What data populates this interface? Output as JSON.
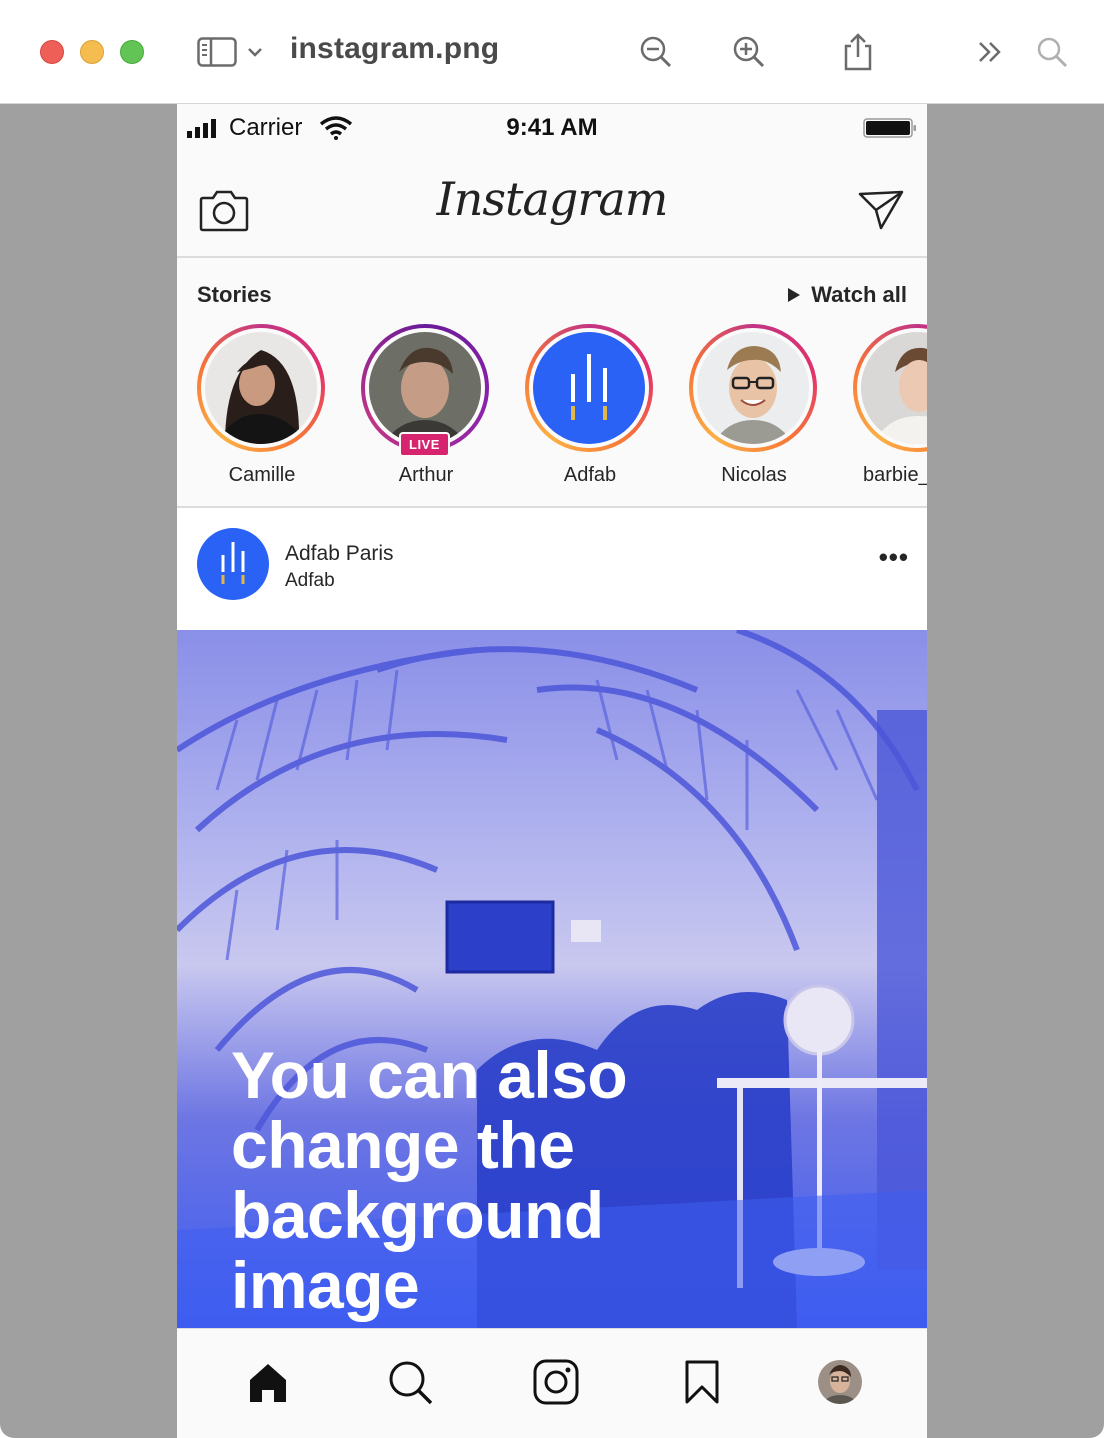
{
  "window": {
    "title": "instagram.png"
  },
  "statusbar": {
    "carrier": "Carrier",
    "time": "9:41 AM"
  },
  "navbar": {
    "logo": "Instagram"
  },
  "stories": {
    "label": "Stories",
    "watch_all": "Watch all",
    "items": [
      {
        "name": "Camille",
        "live": false
      },
      {
        "name": "Arthur",
        "live": true,
        "badge": "LIVE"
      },
      {
        "name": "Adfab",
        "live": false
      },
      {
        "name": "Nicolas",
        "live": false
      },
      {
        "name": "barbie_",
        "live": false
      }
    ]
  },
  "post": {
    "account_name": "Adfab Paris",
    "location": "Adfab",
    "more": "•••",
    "overlay_text": "You can also change the background image"
  },
  "colors": {
    "brand_blue": "#2962f5",
    "live_pink": "#d6246e",
    "story_gradient": [
      "#c13584",
      "#e1306c",
      "#f77737",
      "#fcaf45"
    ]
  },
  "icons": {
    "titlebar": [
      "sidebar-toggle-icon",
      "chevron-down-icon",
      "zoom-out-icon",
      "zoom-in-icon",
      "share-icon",
      "more-chevrons-icon",
      "search-icon"
    ],
    "navbar": [
      "camera-icon",
      "direct-message-icon"
    ],
    "tabbar": [
      "home-icon",
      "search-icon",
      "reels-icon",
      "bookmark-icon",
      "profile-avatar"
    ]
  }
}
